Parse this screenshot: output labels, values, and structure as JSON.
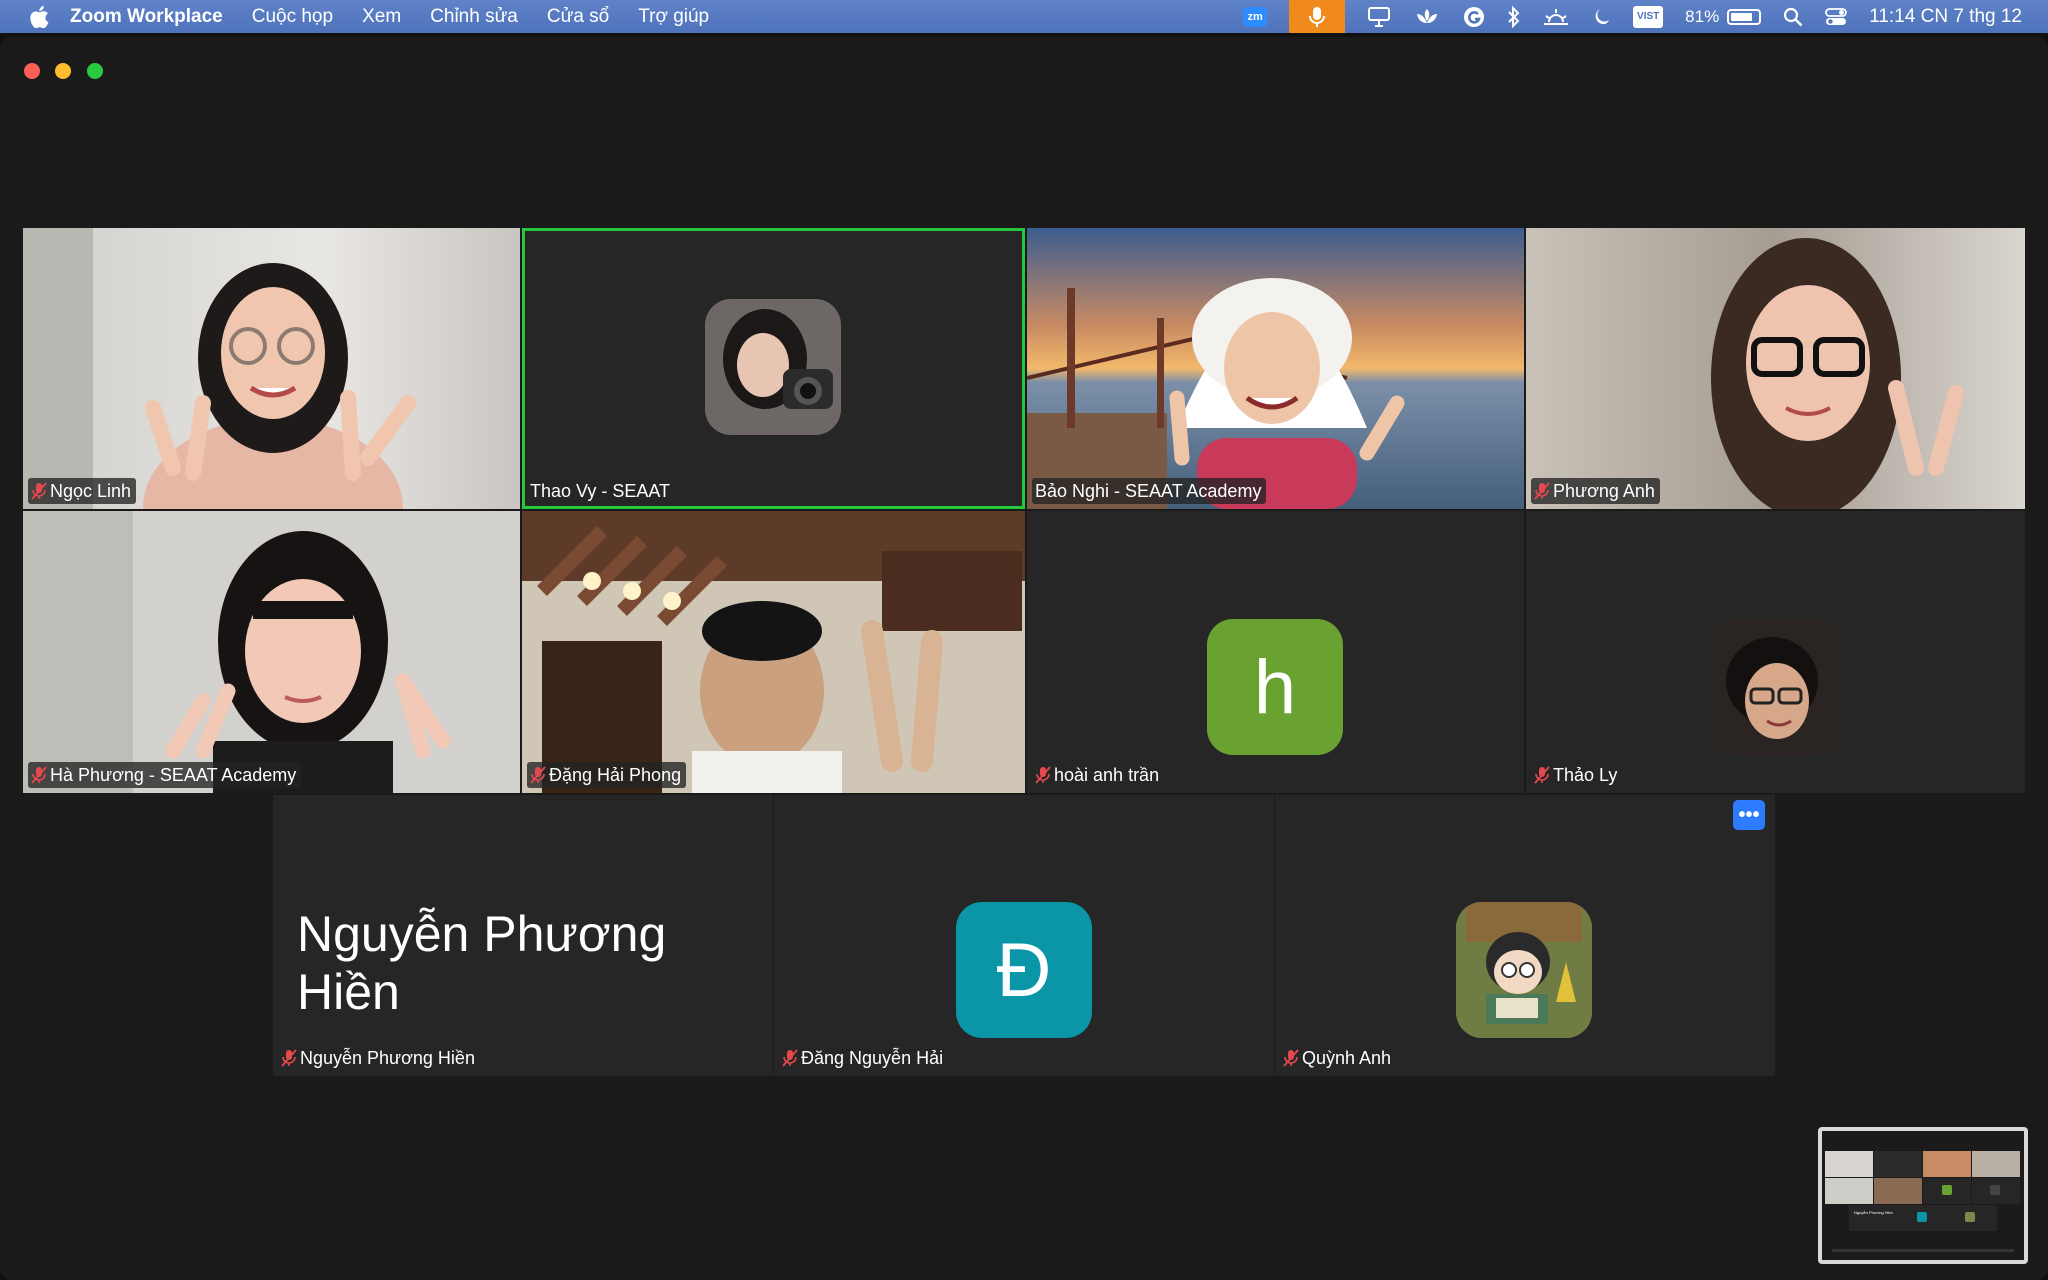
{
  "menubar": {
    "app_name": "Zoom Workplace",
    "menus": [
      "Cuộc họp",
      "Xem",
      "Chỉnh sửa",
      "Cửa sổ",
      "Trợ giúp"
    ],
    "status": {
      "zoom_badge": "zm",
      "vist_badge": "VIST",
      "battery_text": "81%",
      "battery_level": 0.81,
      "clock": "11:14 CN 7 thg 12"
    }
  },
  "participants": [
    {
      "name": "Ngọc Linh",
      "muted": true,
      "mode": "video"
    },
    {
      "name": "Thao Vy - SEAAT",
      "muted": false,
      "mode": "avatar-photo",
      "active_speaker": true
    },
    {
      "name": "Bảo Nghi - SEAAT Academy",
      "muted": false,
      "mode": "video"
    },
    {
      "name": "Phương Anh",
      "muted": true,
      "mode": "video"
    },
    {
      "name": "Hà Phương - SEAAT Academy",
      "muted": true,
      "mode": "video"
    },
    {
      "name": "Đặng Hải Phong",
      "muted": true,
      "mode": "video"
    },
    {
      "name": "hoài anh trần",
      "muted": true,
      "mode": "letter",
      "letter": "h",
      "color": "#6aa232"
    },
    {
      "name": "Thảo Ly",
      "muted": true,
      "mode": "avatar-photo"
    },
    {
      "name": "Nguyễn Phương Hiền",
      "muted": true,
      "mode": "name-only",
      "big_text": "Nguyễn Phương Hiền"
    },
    {
      "name": "Đăng Nguyễn Hải",
      "muted": true,
      "mode": "letter",
      "letter": "Đ",
      "color": "#0a96a6"
    },
    {
      "name": "Quỳnh Anh",
      "muted": true,
      "mode": "avatar-cartoon"
    }
  ],
  "more_button": "•••",
  "thumbnail_caption": "Nguyễn Phương Hiền",
  "colors": {
    "active_speaker": "#25c73b",
    "accent": "#2d7cff",
    "mic_bg": "#f08a1c",
    "menubar": "#5577c0"
  }
}
